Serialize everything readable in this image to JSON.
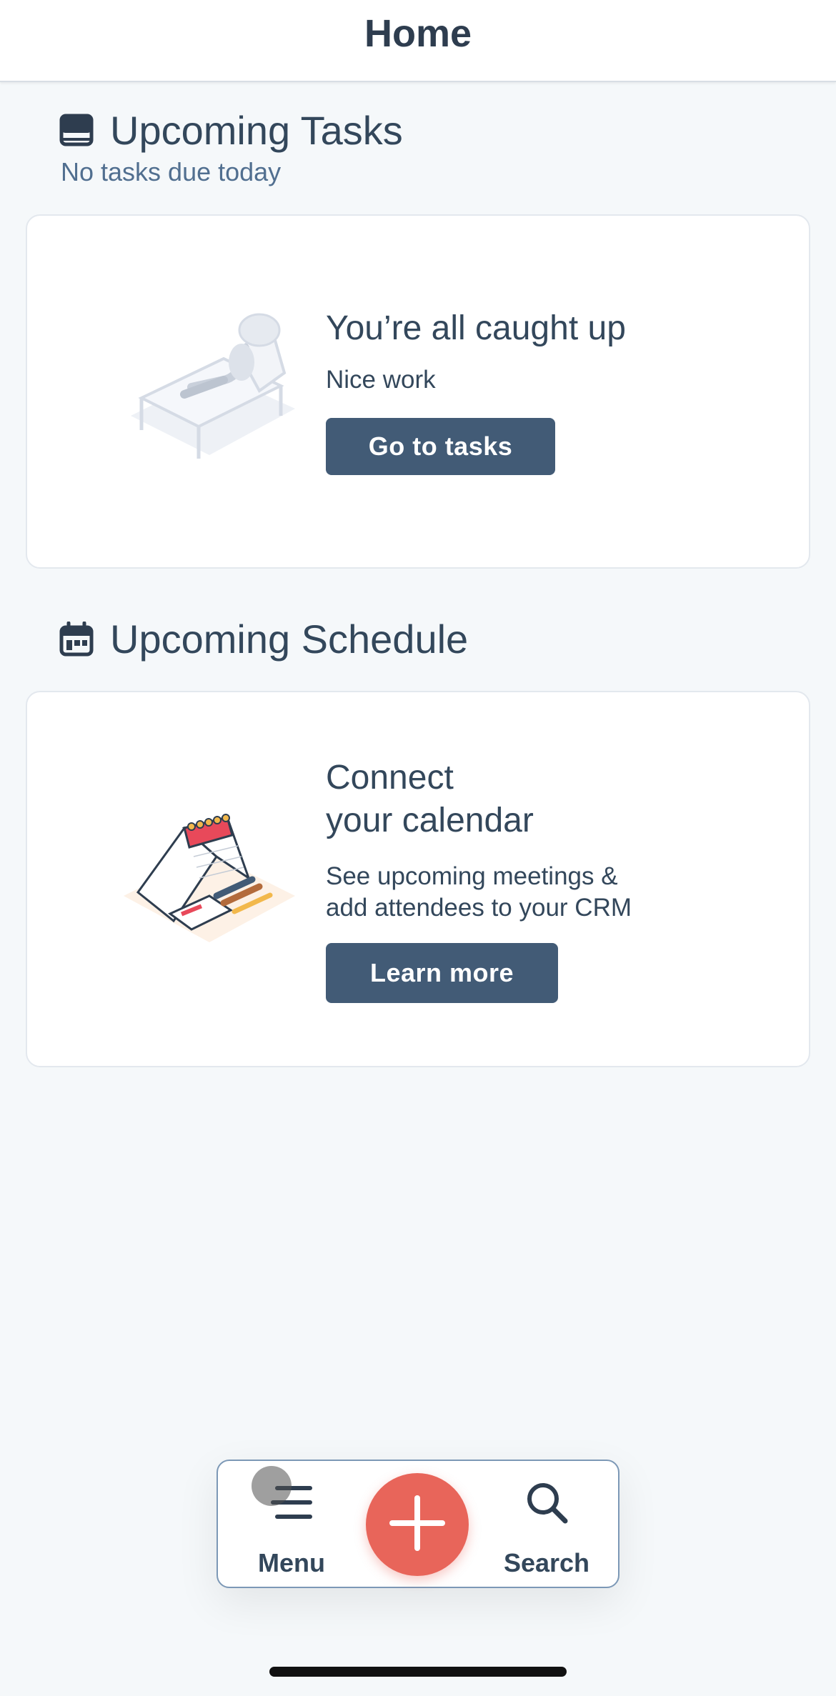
{
  "header": {
    "title": "Home"
  },
  "tasks": {
    "icon": "task-tray-icon",
    "title": "Upcoming Tasks",
    "subtitle": "No tasks due today",
    "card": {
      "illustration": "relaxing-person-illustration",
      "title": "You’re all caught up",
      "text": "Nice work",
      "button": "Go to tasks"
    }
  },
  "schedule": {
    "icon": "calendar-icon",
    "title": "Upcoming Schedule",
    "card": {
      "illustration": "desk-calendar-illustration",
      "title_line1": "Connect",
      "title_line2": "your calendar",
      "text_line1": "See upcoming meetings &",
      "text_line2": "add attendees to your CRM",
      "button": "Learn more"
    }
  },
  "bottom_nav": {
    "menu": {
      "label": "Menu",
      "icon": "hamburger-menu-icon"
    },
    "add": {
      "icon": "plus-icon"
    },
    "search": {
      "label": "Search",
      "icon": "search-icon"
    }
  },
  "colors": {
    "background": "#f5f8fa",
    "button": "#425b76",
    "fab": "#e8655a",
    "text": "#33475b"
  }
}
